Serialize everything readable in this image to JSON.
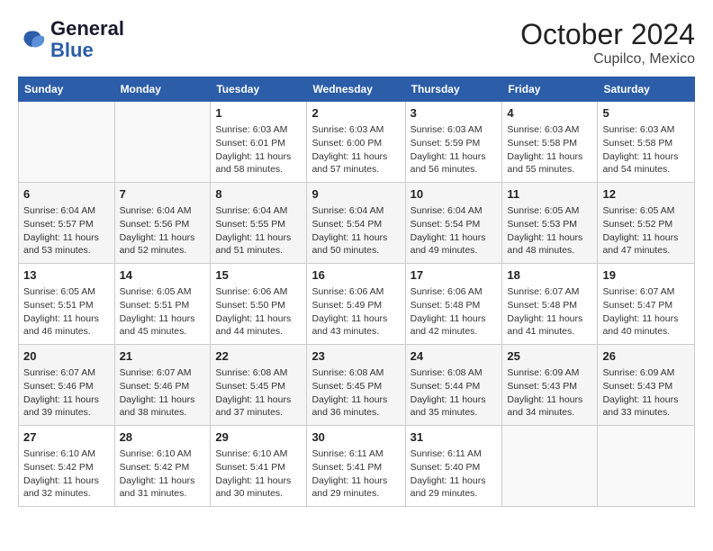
{
  "header": {
    "logo_line1": "General",
    "logo_line2": "Blue",
    "month": "October 2024",
    "location": "Cupilco, Mexico"
  },
  "weekdays": [
    "Sunday",
    "Monday",
    "Tuesday",
    "Wednesday",
    "Thursday",
    "Friday",
    "Saturday"
  ],
  "weeks": [
    [
      {
        "day": "",
        "info": ""
      },
      {
        "day": "",
        "info": ""
      },
      {
        "day": "1",
        "info": "Sunrise: 6:03 AM\nSunset: 6:01 PM\nDaylight: 11 hours and 58 minutes."
      },
      {
        "day": "2",
        "info": "Sunrise: 6:03 AM\nSunset: 6:00 PM\nDaylight: 11 hours and 57 minutes."
      },
      {
        "day": "3",
        "info": "Sunrise: 6:03 AM\nSunset: 5:59 PM\nDaylight: 11 hours and 56 minutes."
      },
      {
        "day": "4",
        "info": "Sunrise: 6:03 AM\nSunset: 5:58 PM\nDaylight: 11 hours and 55 minutes."
      },
      {
        "day": "5",
        "info": "Sunrise: 6:03 AM\nSunset: 5:58 PM\nDaylight: 11 hours and 54 minutes."
      }
    ],
    [
      {
        "day": "6",
        "info": "Sunrise: 6:04 AM\nSunset: 5:57 PM\nDaylight: 11 hours and 53 minutes."
      },
      {
        "day": "7",
        "info": "Sunrise: 6:04 AM\nSunset: 5:56 PM\nDaylight: 11 hours and 52 minutes."
      },
      {
        "day": "8",
        "info": "Sunrise: 6:04 AM\nSunset: 5:55 PM\nDaylight: 11 hours and 51 minutes."
      },
      {
        "day": "9",
        "info": "Sunrise: 6:04 AM\nSunset: 5:54 PM\nDaylight: 11 hours and 50 minutes."
      },
      {
        "day": "10",
        "info": "Sunrise: 6:04 AM\nSunset: 5:54 PM\nDaylight: 11 hours and 49 minutes."
      },
      {
        "day": "11",
        "info": "Sunrise: 6:05 AM\nSunset: 5:53 PM\nDaylight: 11 hours and 48 minutes."
      },
      {
        "day": "12",
        "info": "Sunrise: 6:05 AM\nSunset: 5:52 PM\nDaylight: 11 hours and 47 minutes."
      }
    ],
    [
      {
        "day": "13",
        "info": "Sunrise: 6:05 AM\nSunset: 5:51 PM\nDaylight: 11 hours and 46 minutes."
      },
      {
        "day": "14",
        "info": "Sunrise: 6:05 AM\nSunset: 5:51 PM\nDaylight: 11 hours and 45 minutes."
      },
      {
        "day": "15",
        "info": "Sunrise: 6:06 AM\nSunset: 5:50 PM\nDaylight: 11 hours and 44 minutes."
      },
      {
        "day": "16",
        "info": "Sunrise: 6:06 AM\nSunset: 5:49 PM\nDaylight: 11 hours and 43 minutes."
      },
      {
        "day": "17",
        "info": "Sunrise: 6:06 AM\nSunset: 5:48 PM\nDaylight: 11 hours and 42 minutes."
      },
      {
        "day": "18",
        "info": "Sunrise: 6:07 AM\nSunset: 5:48 PM\nDaylight: 11 hours and 41 minutes."
      },
      {
        "day": "19",
        "info": "Sunrise: 6:07 AM\nSunset: 5:47 PM\nDaylight: 11 hours and 40 minutes."
      }
    ],
    [
      {
        "day": "20",
        "info": "Sunrise: 6:07 AM\nSunset: 5:46 PM\nDaylight: 11 hours and 39 minutes."
      },
      {
        "day": "21",
        "info": "Sunrise: 6:07 AM\nSunset: 5:46 PM\nDaylight: 11 hours and 38 minutes."
      },
      {
        "day": "22",
        "info": "Sunrise: 6:08 AM\nSunset: 5:45 PM\nDaylight: 11 hours and 37 minutes."
      },
      {
        "day": "23",
        "info": "Sunrise: 6:08 AM\nSunset: 5:45 PM\nDaylight: 11 hours and 36 minutes."
      },
      {
        "day": "24",
        "info": "Sunrise: 6:08 AM\nSunset: 5:44 PM\nDaylight: 11 hours and 35 minutes."
      },
      {
        "day": "25",
        "info": "Sunrise: 6:09 AM\nSunset: 5:43 PM\nDaylight: 11 hours and 34 minutes."
      },
      {
        "day": "26",
        "info": "Sunrise: 6:09 AM\nSunset: 5:43 PM\nDaylight: 11 hours and 33 minutes."
      }
    ],
    [
      {
        "day": "27",
        "info": "Sunrise: 6:10 AM\nSunset: 5:42 PM\nDaylight: 11 hours and 32 minutes."
      },
      {
        "day": "28",
        "info": "Sunrise: 6:10 AM\nSunset: 5:42 PM\nDaylight: 11 hours and 31 minutes."
      },
      {
        "day": "29",
        "info": "Sunrise: 6:10 AM\nSunset: 5:41 PM\nDaylight: 11 hours and 30 minutes."
      },
      {
        "day": "30",
        "info": "Sunrise: 6:11 AM\nSunset: 5:41 PM\nDaylight: 11 hours and 29 minutes."
      },
      {
        "day": "31",
        "info": "Sunrise: 6:11 AM\nSunset: 5:40 PM\nDaylight: 11 hours and 29 minutes."
      },
      {
        "day": "",
        "info": ""
      },
      {
        "day": "",
        "info": ""
      }
    ]
  ]
}
